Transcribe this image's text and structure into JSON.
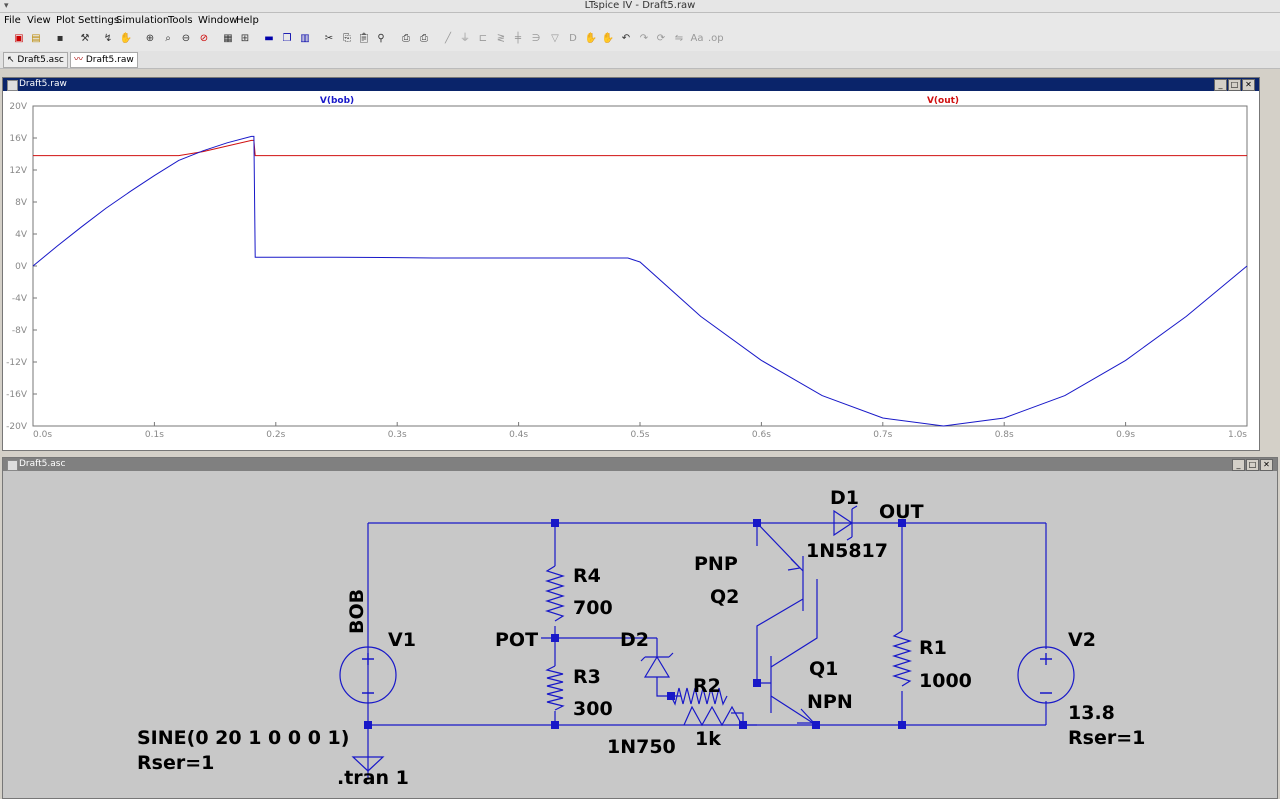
{
  "app": {
    "title": "LTspice IV - Draft5.raw"
  },
  "menu": [
    "File",
    "View",
    "Plot Settings",
    "Simulation",
    "Tools",
    "Window",
    "Help"
  ],
  "tabs": [
    {
      "label": "Draft5.asc",
      "icon": "schematic-icon",
      "active": false
    },
    {
      "label": "Draft5.raw",
      "icon": "waveform-icon",
      "active": true
    }
  ],
  "plot_window": {
    "title": "Draft5.raw"
  },
  "schematic_window": {
    "title": "Draft5.asc"
  },
  "chart_data": {
    "type": "line",
    "xlabel": "",
    "ylabel": "",
    "xlim": [
      0,
      1
    ],
    "ylim": [
      -20,
      20
    ],
    "x_ticks": [
      "0.0s",
      "0.1s",
      "0.2s",
      "0.3s",
      "0.4s",
      "0.5s",
      "0.6s",
      "0.7s",
      "0.8s",
      "0.9s",
      "1.0s"
    ],
    "y_ticks": [
      "20V",
      "16V",
      "12V",
      "8V",
      "4V",
      "0V",
      "-4V",
      "-8V",
      "-12V",
      "-16V",
      "-20V"
    ],
    "grid": false,
    "series": [
      {
        "name": "V(bob)",
        "color": "#1818c8",
        "x": [
          0,
          0.02,
          0.04,
          0.06,
          0.08,
          0.1,
          0.12,
          0.14,
          0.16,
          0.18,
          0.182,
          0.183,
          0.25,
          0.3,
          0.33,
          0.4,
          0.45,
          0.49,
          0.5,
          0.55,
          0.6,
          0.65,
          0.7,
          0.75,
          0.8,
          0.85,
          0.9,
          0.95,
          1.0
        ],
        "y": [
          0,
          2.5,
          4.9,
          7.2,
          9.3,
          11.3,
          13.2,
          14.4,
          15.4,
          16.2,
          16.2,
          1.1,
          1.1,
          1.05,
          1.0,
          1.0,
          1.0,
          1.0,
          0.5,
          -6.3,
          -11.8,
          -16.2,
          -19.0,
          -20.0,
          -19.0,
          -16.2,
          -11.8,
          -6.3,
          0
        ]
      },
      {
        "name": "V(out)",
        "color": "#d01010",
        "x": [
          0,
          0.12,
          0.14,
          0.16,
          0.18,
          0.182,
          0.183,
          0.3,
          0.5,
          0.7,
          1.0
        ],
        "y": [
          13.8,
          13.8,
          14.3,
          15.0,
          15.7,
          15.7,
          13.8,
          13.8,
          13.8,
          13.8,
          13.8
        ]
      }
    ]
  },
  "schematic": {
    "labels": {
      "d1": "D1",
      "out": "OUT",
      "d1_model": "1N5817",
      "pnp": "PNP",
      "q2": "Q2",
      "r4": "R4",
      "r4_val": "700",
      "bob": "BOB",
      "v1": "V1",
      "pot": "POT",
      "d2": "D2",
      "r3": "R3",
      "r3_val": "300",
      "r2": "R2",
      "q1": "Q1",
      "npn": "NPN",
      "r1": "R1",
      "r1_val": "1000",
      "v2": "V2",
      "v2_val": "13.8",
      "v2_rser": "Rser=1",
      "v1_sine": "SINE(0 20 1 0 0 0 1)",
      "v1_rser": "Rser=1",
      "d2_model": "1N750",
      "r2_val": "1k",
      "tran": ".tran 1"
    }
  },
  "colors": {
    "wire": "#1818c8",
    "schematic_bg": "#c8c8c8",
    "title_active": "#0a246a",
    "title_inactive": "#808080"
  }
}
